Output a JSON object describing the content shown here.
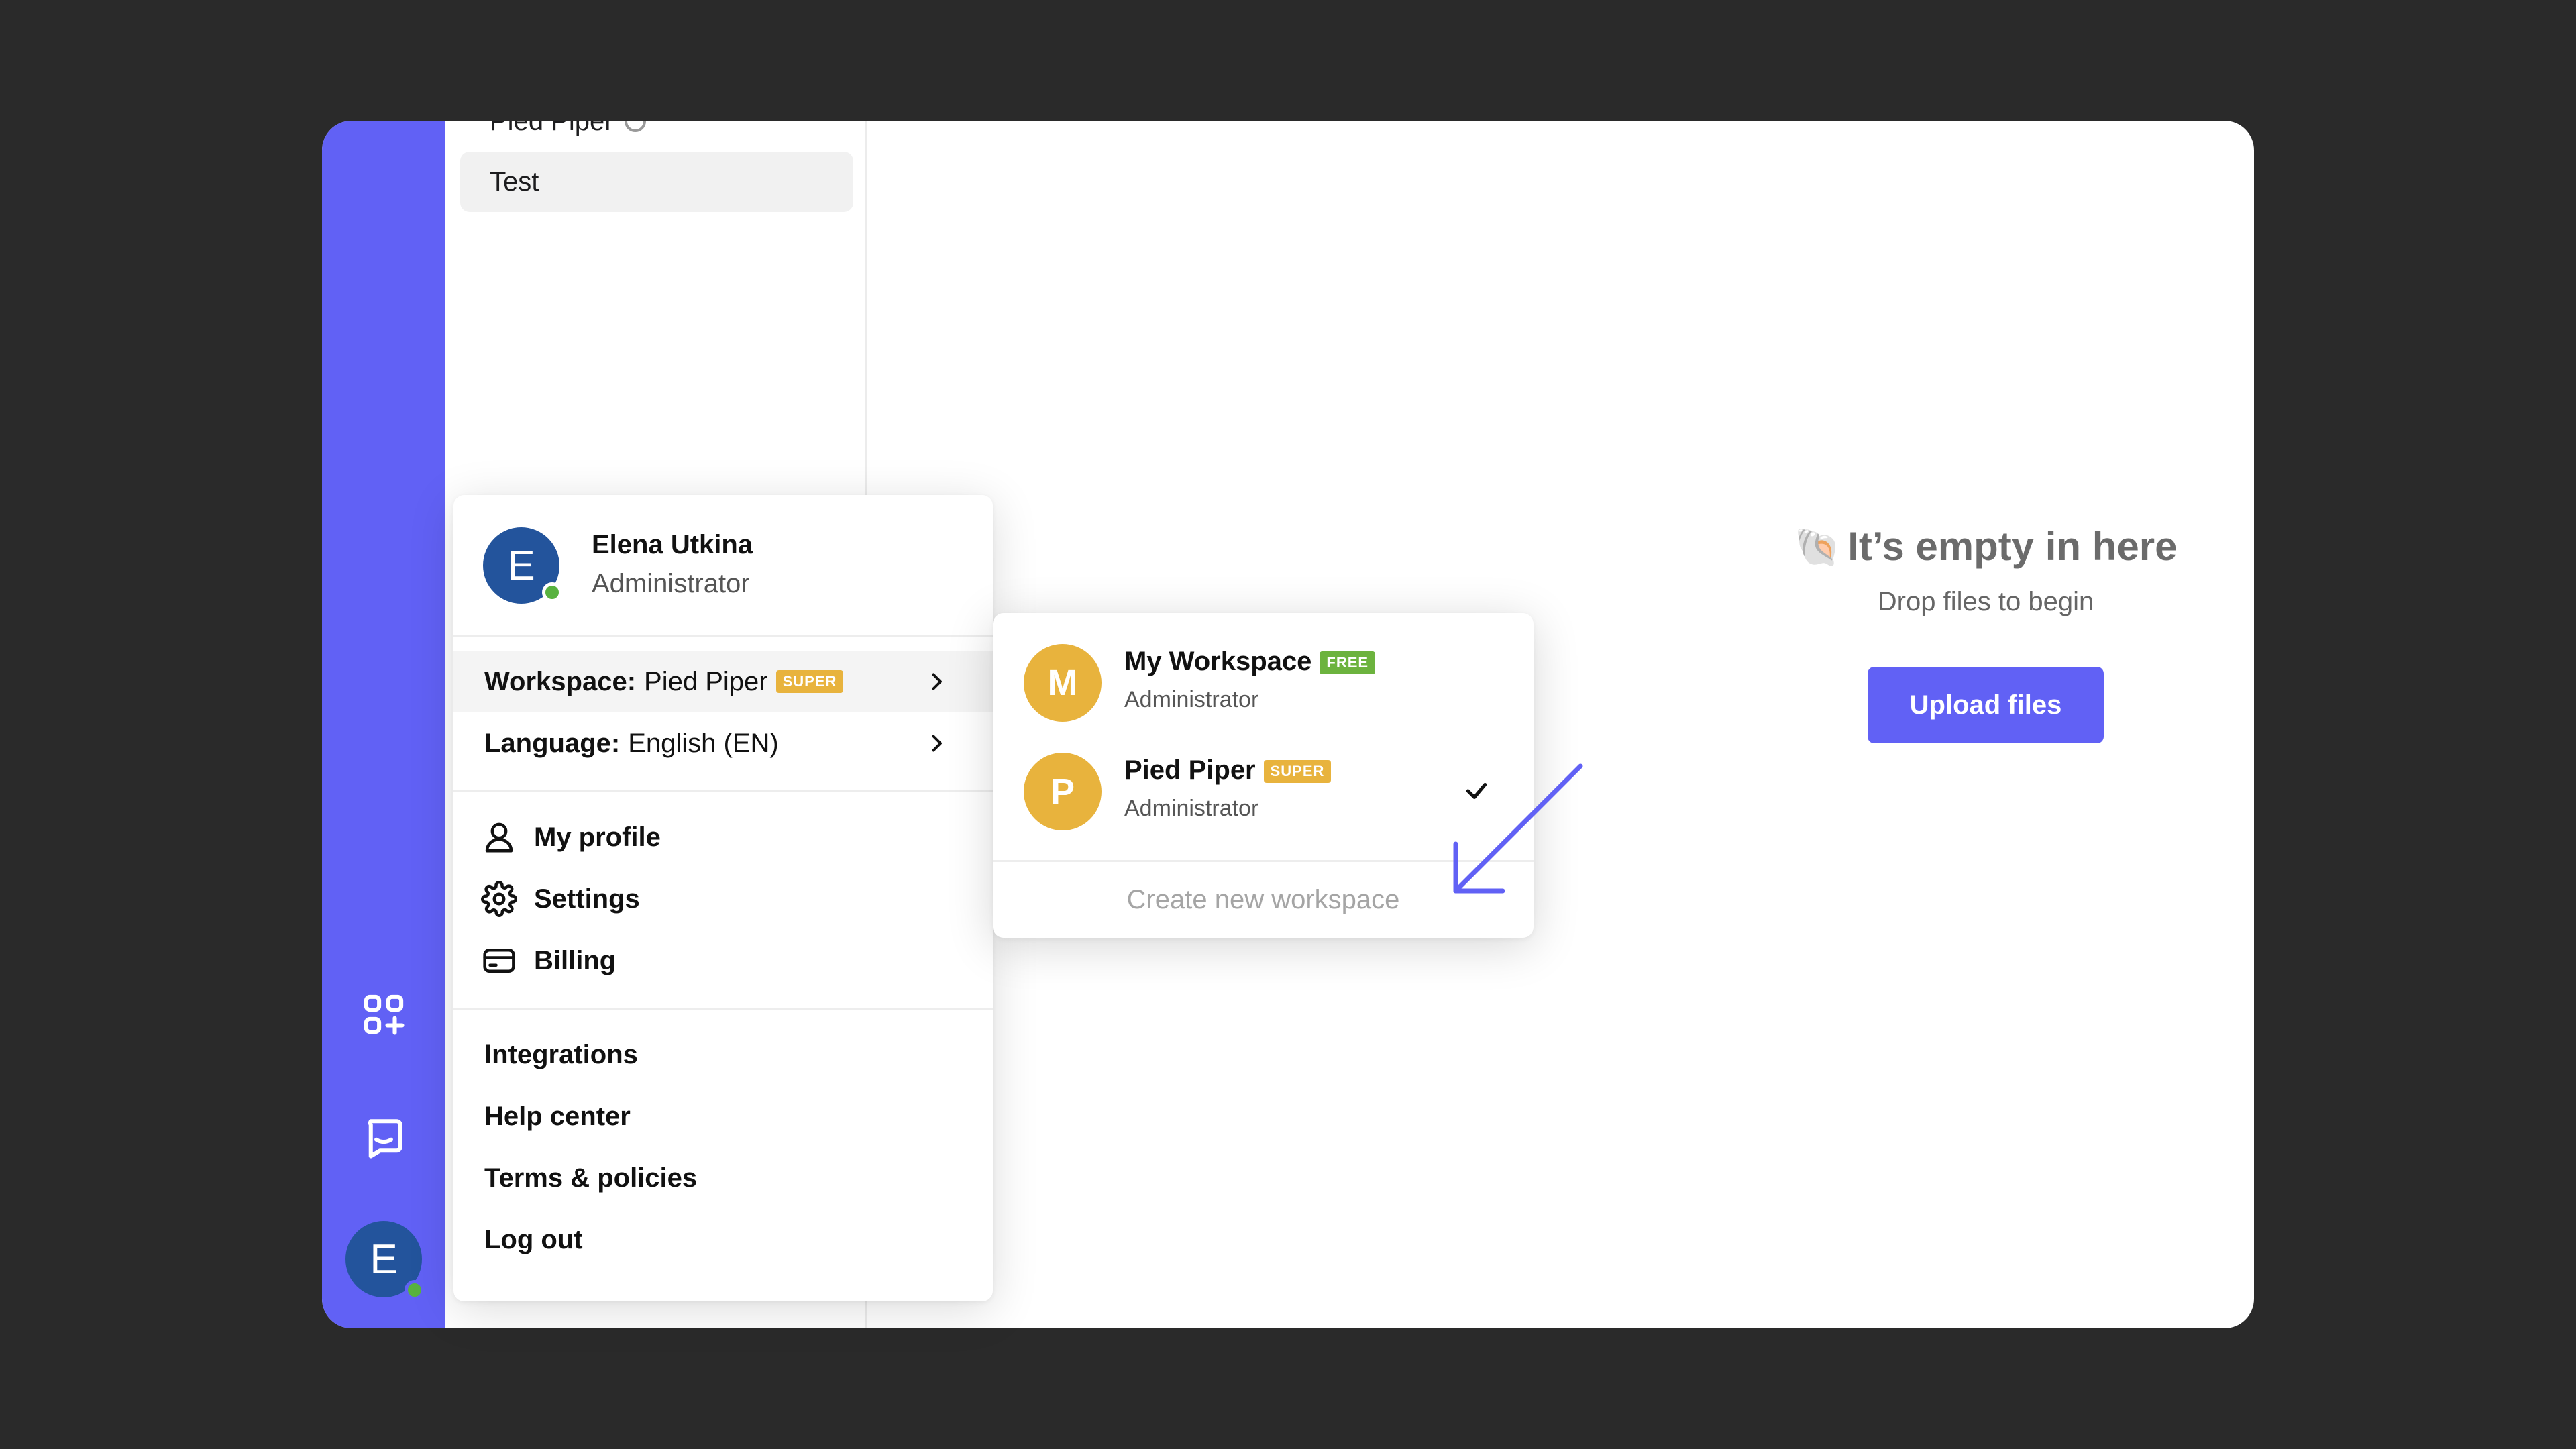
{
  "sidebar_list": {
    "items": [
      {
        "label": "Pied Piper",
        "icon": "verified-check-icon"
      },
      {
        "label": "Test"
      }
    ]
  },
  "empty_state": {
    "emoji": "🐚",
    "title": "It’s empty in here",
    "subtitle": "Drop files to begin",
    "upload_button": "Upload files"
  },
  "user": {
    "initial": "E",
    "name": "Elena Utkina",
    "role": "Administrator",
    "status": "online"
  },
  "account_menu": {
    "workspace_label": "Workspace:",
    "workspace_value": "Pied Piper",
    "workspace_badge": "SUPER",
    "language_label": "Language:",
    "language_value": "English (EN)",
    "my_profile": "My profile",
    "settings": "Settings",
    "billing": "Billing",
    "integrations": "Integrations",
    "help_center": "Help center",
    "terms": "Terms & policies",
    "log_out": "Log out"
  },
  "workspace_menu": {
    "workspaces": [
      {
        "initial": "M",
        "name": "My Workspace",
        "badge": "FREE",
        "badge_color": "#6cb33e",
        "role": "Administrator",
        "selected": false
      },
      {
        "initial": "P",
        "name": "Pied Piper",
        "badge": "SUPER",
        "badge_color": "#e8b33d",
        "role": "Administrator",
        "selected": true
      }
    ],
    "create_label": "Create new workspace"
  },
  "colors": {
    "accent": "#6161f5",
    "avatar_blue": "#23549c",
    "workspace_avatar": "#e8b33d",
    "online": "#58b23f"
  }
}
